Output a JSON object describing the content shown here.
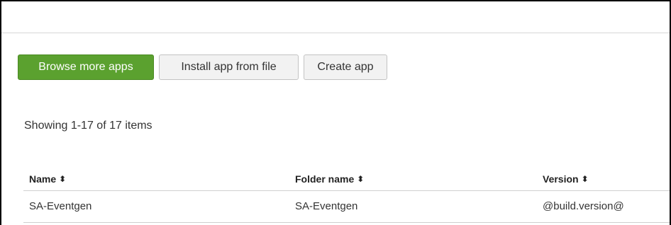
{
  "toolbar": {
    "browse_label": "Browse more apps",
    "install_label": "Install app from file",
    "create_label": "Create app"
  },
  "listing": {
    "count_text": "Showing 1-17 of 17 items"
  },
  "table": {
    "columns": [
      {
        "label": "Name",
        "sort_icon": "⬍"
      },
      {
        "label": "Folder name",
        "sort_icon": "⬍"
      },
      {
        "label": "Version",
        "sort_icon": "⬍"
      }
    ],
    "rows": [
      {
        "name": "SA-Eventgen",
        "folder": "SA-Eventgen",
        "version": "@build.version@"
      }
    ]
  },
  "colors": {
    "primary_button": "#5ba12f",
    "secondary_button": "#f2f2f2"
  }
}
